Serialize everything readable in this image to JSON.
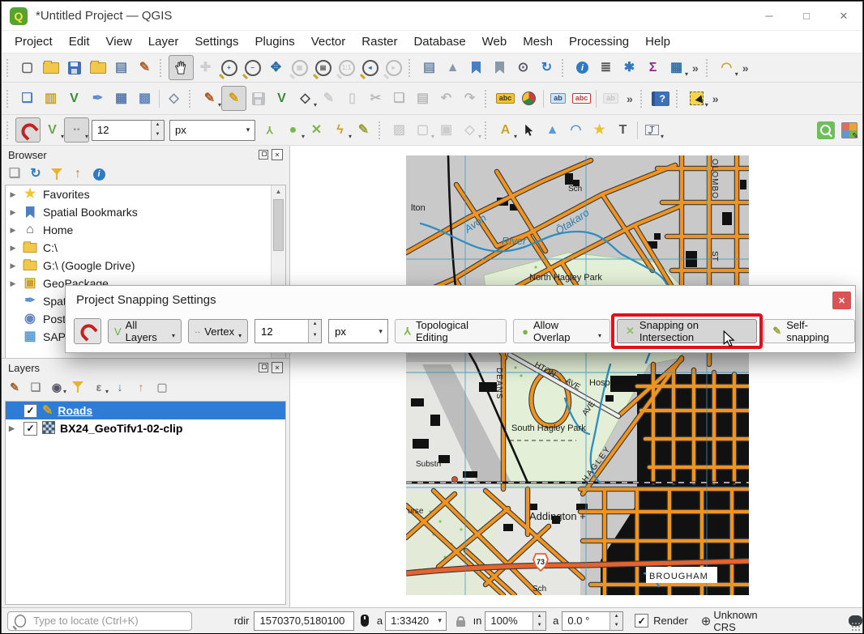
{
  "window": {
    "title": "*Untitled Project — QGIS",
    "controls": {
      "minimize": "─",
      "maximize": "□",
      "close": "✕"
    },
    "logo_letter": "Q"
  },
  "menu": {
    "items": [
      "Project",
      "Edit",
      "View",
      "Layer",
      "Settings",
      "Plugins",
      "Vector",
      "Raster",
      "Database",
      "Web",
      "Mesh",
      "Processing",
      "Help"
    ]
  },
  "toolbars": {
    "row1": [
      {
        "t": "sep"
      },
      {
        "n": "new-project",
        "g": "▢",
        "c": "#666"
      },
      {
        "n": "open-project",
        "k": "folder"
      },
      {
        "n": "save-project",
        "k": "floppy"
      },
      {
        "n": "style-manager",
        "k": "folder"
      },
      {
        "n": "project-properties",
        "g": "▤",
        "c": "#5b7fa6"
      },
      {
        "n": "symbology",
        "g": "✎",
        "c": "#b06030"
      },
      {
        "t": "sep"
      },
      {
        "n": "pan-map",
        "k": "hand",
        "st": "active"
      },
      {
        "n": "pan-to-selection",
        "g": "✚",
        "c": "#5b9bd5",
        "st": "disabled"
      },
      {
        "n": "zoom-in",
        "k": "mag",
        "g": "+",
        "c": "#2e6da4"
      },
      {
        "n": "zoom-out",
        "k": "mag",
        "g": "−",
        "c": "#2e6da4"
      },
      {
        "n": "zoom-full-extent",
        "g": "✥",
        "c": "#2e6da4"
      },
      {
        "n": "zoom-to-selection",
        "k": "mag",
        "g": "▣",
        "c": "#888",
        "st": "disabled"
      },
      {
        "n": "zoom-to-layer",
        "k": "mag",
        "g": "▤",
        "c": "#555"
      },
      {
        "n": "zoom-native",
        "k": "mag",
        "g": "1:1",
        "c": "#888",
        "st": "disabled"
      },
      {
        "n": "zoom-last",
        "k": "mag",
        "g": "◂",
        "c": "#2e6da4"
      },
      {
        "n": "zoom-next",
        "k": "mag",
        "g": "▸",
        "c": "#888",
        "st": "disabled"
      },
      {
        "t": "sep"
      },
      {
        "n": "new-map-view",
        "g": "▤",
        "c": "#6b86a8"
      },
      {
        "n": "new-3d-map-view",
        "g": "▲",
        "c": "#8899aa"
      },
      {
        "n": "new-spatial-bookmark",
        "k": "bm",
        "c": "#4a7fc1"
      },
      {
        "n": "show-spatial-bookmarks",
        "k": "bm",
        "c": "#8899aa"
      },
      {
        "n": "temporal-controller",
        "g": "⊙",
        "c": "#556"
      },
      {
        "n": "refresh-map",
        "g": "↻",
        "c": "#2e7bc4"
      },
      {
        "t": "sep"
      },
      {
        "n": "identify-features",
        "k": "badgei"
      },
      {
        "n": "statistical-summary",
        "g": "≣",
        "c": "#555"
      },
      {
        "n": "processing-toolbox",
        "g": "✱",
        "c": "#2e7bc4"
      },
      {
        "n": "show-statistics",
        "g": "Σ",
        "c": "#8e2a8e"
      },
      {
        "n": "attribute-table",
        "g": "▦",
        "c": "#2e6da4",
        "dd": true
      },
      {
        "t": "over"
      },
      {
        "t": "sep"
      },
      {
        "n": "circular-string-tool",
        "g": "◠",
        "c": "#caa42c",
        "dd": true
      },
      {
        "t": "over"
      }
    ],
    "row2": [
      {
        "t": "sep"
      },
      {
        "n": "data-source-manager",
        "g": "❏",
        "c": "#4a7fc1"
      },
      {
        "n": "add-vector-layer",
        "g": "▥",
        "c": "#c9a227"
      },
      {
        "n": "new-vector-layer",
        "g": "V",
        "c": "#3c8a3c"
      },
      {
        "n": "new-geopackage-layer",
        "g": "✒",
        "c": "#5b8bd0"
      },
      {
        "n": "new-spatialite-layer",
        "g": "▦",
        "c": "#5577aa"
      },
      {
        "n": "new-raster-layer",
        "g": "▩",
        "c": "#6688bb"
      },
      {
        "t": "bar"
      },
      {
        "n": "new-mesh-layer",
        "g": "◇",
        "c": "#7a8aa0"
      },
      {
        "t": "sep"
      },
      {
        "n": "current-edits",
        "g": "✎",
        "c": "#b05a2a",
        "dd": true
      },
      {
        "n": "toggle-editing",
        "g": "✎",
        "c": "#d4a017",
        "st": "active"
      },
      {
        "n": "save-edits",
        "k": "floppy",
        "st": "disabled"
      },
      {
        "n": "add-feature",
        "g": "V",
        "c": "#3c8a3c"
      },
      {
        "n": "vertex-tool",
        "g": "◇",
        "c": "#444",
        "dd": true
      },
      {
        "n": "multiedit-attributes",
        "g": "✎",
        "c": "#888",
        "st": "disabled"
      },
      {
        "n": "delete-selected",
        "g": "▯",
        "c": "#888",
        "st": "disabled"
      },
      {
        "n": "cut-features",
        "g": "✂",
        "c": "#555",
        "st": "disabled"
      },
      {
        "n": "copy-features",
        "g": "❏",
        "c": "#555",
        "st": "disabled"
      },
      {
        "n": "paste-features",
        "g": "▤",
        "c": "#555",
        "st": "disabled"
      },
      {
        "n": "undo",
        "g": "↶",
        "c": "#555",
        "st": "disabled"
      },
      {
        "n": "redo",
        "g": "↷",
        "c": "#555",
        "st": "disabled"
      },
      {
        "t": "sep"
      },
      {
        "n": "layer-labeling",
        "k": "tag",
        "g": "abc",
        "c": "y"
      },
      {
        "n": "layer-diagram",
        "k": "pie"
      },
      {
        "t": "bar"
      },
      {
        "n": "pin-labels",
        "k": "tag",
        "g": "ab",
        "c": "b"
      },
      {
        "n": "highlight-pinned-labels",
        "k": "tag",
        "g": "abc",
        "c": "r"
      },
      {
        "t": "bar"
      },
      {
        "n": "move-label",
        "k": "tag",
        "g": "ab",
        "c": "g",
        "st": "disabled"
      },
      {
        "t": "over"
      },
      {
        "t": "sep"
      },
      {
        "n": "help",
        "k": "help"
      },
      {
        "t": "sep"
      },
      {
        "n": "select-features",
        "k": "selbox",
        "dd": true
      },
      {
        "t": "over"
      }
    ],
    "row3": [
      {
        "t": "sep"
      },
      {
        "n": "enable-snapping",
        "k": "magnet",
        "st": "active"
      },
      {
        "n": "snapping-mode",
        "g": "V",
        "c": "#6aa84f",
        "dd": true
      },
      {
        "n": "snapping-type",
        "g": "∙∙",
        "c": "#8a8a8a",
        "dd": true,
        "st": "active"
      },
      {
        "t": "spin",
        "n": "snapping-tolerance",
        "v": "12",
        "w": 88
      },
      {
        "t": "combo",
        "n": "snapping-units",
        "v": "px",
        "w": 104
      },
      {
        "n": "topological-editing",
        "k": "topo"
      },
      {
        "n": "avoid-overlap",
        "g": "●",
        "c": "#7ab648",
        "dd": true
      },
      {
        "n": "snapping-on-intersection",
        "g": "✕",
        "c": "#7ab648"
      },
      {
        "n": "tracing",
        "g": "ϟ",
        "c": "#d4a017",
        "dd": true
      },
      {
        "n": "self-snapping",
        "g": "✎",
        "c": "#9aa13a"
      },
      {
        "t": "sep"
      },
      {
        "n": "advanced-digitizing-panel",
        "g": "▨",
        "c": "#888",
        "st": "disabled"
      },
      {
        "n": "cad-tools",
        "g": "▢",
        "c": "#888",
        "st": "disabled",
        "dd": true
      },
      {
        "n": "construction-mode",
        "g": "▣",
        "c": "#888",
        "st": "disabled"
      },
      {
        "n": "shape-digitizing",
        "g": "◇",
        "c": "#888",
        "st": "disabled",
        "dd": true
      },
      {
        "t": "sep"
      },
      {
        "n": "create-annotation",
        "g": "A",
        "c": "#caa42c",
        "dd": true
      },
      {
        "n": "select-annotation",
        "k": "cursor"
      },
      {
        "n": "polygon-annotation",
        "g": "▲",
        "c": "#5b9bd5"
      },
      {
        "n": "line-annotation",
        "g": "◠",
        "c": "#5b9bd5"
      },
      {
        "n": "marker-annotation",
        "g": "★",
        "c": "#e8c23a"
      },
      {
        "n": "text-annotation",
        "g": "T",
        "c": "#555"
      },
      {
        "t": "bar"
      },
      {
        "n": "balloon-annotation",
        "k": "balloon",
        "dd": true
      },
      {
        "t": "flex"
      },
      {
        "n": "zoom-search",
        "k": "greensq"
      },
      {
        "n": "layer-styling-panel",
        "k": "stylemap"
      }
    ]
  },
  "browser": {
    "title": "Browser",
    "toolbar": [
      {
        "n": "add-selected-layers",
        "g": "❏",
        "c": "#999"
      },
      {
        "n": "refresh-browser",
        "g": "↻",
        "c": "#2e7bc4"
      },
      {
        "n": "filter-browser",
        "k": "funnel"
      },
      {
        "n": "collapse-all",
        "g": "↑",
        "c": "#c97b2a"
      },
      {
        "n": "browser-properties",
        "k": "badgei"
      }
    ],
    "items": [
      {
        "label": "Favorites",
        "arrow": true,
        "icon": {
          "g": "★",
          "c": "#f2c430"
        }
      },
      {
        "label": "Spatial Bookmarks",
        "arrow": true,
        "icon": {
          "k": "bm",
          "c": "#4a7fc1"
        }
      },
      {
        "label": "Home",
        "arrow": true,
        "icon": {
          "g": "⌂",
          "c": "#555"
        }
      },
      {
        "label": "C:\\",
        "arrow": true,
        "icon": {
          "k": "folder-s"
        }
      },
      {
        "label": "G:\\ (Google Drive)",
        "arrow": true,
        "icon": {
          "k": "folder-s"
        }
      },
      {
        "label": "GeoPackage",
        "arrow": true,
        "icon": {
          "g": "▣",
          "c": "#c9a227"
        }
      },
      {
        "label": "SpatiaLite",
        "arrow": false,
        "icon": {
          "g": "✒",
          "c": "#5b8bd0"
        }
      },
      {
        "label": "PostGIS",
        "arrow": false,
        "icon": {
          "g": "◉",
          "c": "#6688bb"
        }
      },
      {
        "label": "SAP HANA",
        "arrow": false,
        "icon": {
          "g": "▦",
          "c": "#5b9bd5"
        }
      }
    ]
  },
  "layers": {
    "title": "Layers",
    "toolbar": [
      {
        "n": "open-layer-styling",
        "g": "✎",
        "c": "#a0622d"
      },
      {
        "n": "add-group",
        "g": "❏",
        "c": "#888"
      },
      {
        "n": "manage-map-themes",
        "g": "◉",
        "c": "#556",
        "dd": true
      },
      {
        "n": "filter-legend",
        "k": "funnel"
      },
      {
        "n": "filter-expression",
        "g": "ε",
        "c": "#777",
        "dd": true
      },
      {
        "n": "expand-all",
        "g": "↓",
        "c": "#2e7bc4"
      },
      {
        "n": "collapse-all-layers",
        "g": "↑",
        "c": "#c97b2a"
      },
      {
        "n": "remove-layer",
        "g": "▢",
        "c": "#999"
      }
    ],
    "items": [
      {
        "label": "Roads",
        "checked": true,
        "selected": true,
        "underline": true,
        "arrow": false,
        "icon": {
          "g": "✎",
          "c": "#caa42c"
        }
      },
      {
        "label": "BX24_GeoTifv1-02-clip",
        "checked": true,
        "selected": false,
        "underline": false,
        "arrow": true,
        "icon": {
          "k": "raster"
        }
      }
    ]
  },
  "dialog": {
    "title": "Project Snapping Settings",
    "close_glyph": "✕",
    "tolerance": "12",
    "units": "px",
    "buttons": {
      "all_layers": "All Layers",
      "vertex": "Vertex",
      "topological": "Topological Editing",
      "overlap": "Allow Overlap",
      "intersection": "Snapping on Intersection",
      "self_snapping": "Self-snapping"
    }
  },
  "statusbar": {
    "locator_placeholder": "Type to locate (Ctrl+K)",
    "coord_label": "rdir",
    "coordinate": "1570370,5180100",
    "scale_label": "a",
    "scale": "1:33420",
    "magnifier_label": "ın",
    "magnifier": "100%",
    "rotation_label": "a",
    "rotation": "0.0 °",
    "render_label": "Render",
    "crs": "Unknown CRS"
  },
  "map": {
    "colors": {
      "bg": "#c9c9c9",
      "road": "#f0941f",
      "river": "#2d8fc0",
      "park": "#e3efd6",
      "highway": "#e8622d"
    },
    "labels": {
      "lton": "lton",
      "sch_top": "Sch",
      "avon": "Avon",
      "river": "River",
      "otakaro": "Ōtakaro",
      "north_hagley": "North Hagley Park",
      "colombo": "OLOMBO",
      "st": "ST",
      "deans": "DEANS",
      "hton": "HTON",
      "ave1": "AVE",
      "hosp": "Hosp",
      "south_hagley": "South Hagley Park",
      "hagley": "HAGLEY",
      "ave2": "AVE",
      "substn": "Substn",
      "urse": "urse",
      "addington": "Addington +",
      "hwy": "73",
      "sch_bottom": "Sch",
      "brougham": "BROUGHAM"
    }
  }
}
